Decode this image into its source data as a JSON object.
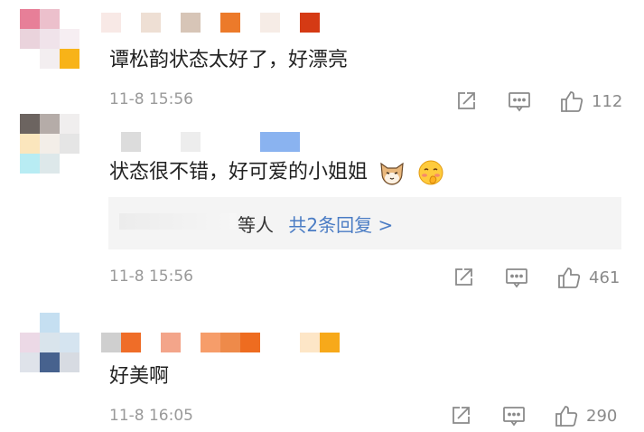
{
  "comments": [
    {
      "text": "谭松韵状态太好了，好漂亮",
      "time": "11-8 15:56",
      "likes": "112"
    },
    {
      "text": "状态很不错，好可爱的小姐姐",
      "emojis": [
        "cat-face-emoji",
        "blushing-face-emoji"
      ],
      "reply_people": "等人",
      "reply_link": "共2条回复 >",
      "time": "11-8 15:56",
      "likes": "461"
    },
    {
      "text": "好美啊",
      "time": "11-8 16:05",
      "likes": "290"
    }
  ],
  "icons": {
    "share": "share-icon",
    "comment": "comment-icon",
    "like": "thumbs-up-icon"
  },
  "colors": {
    "link": "#4a7cc4",
    "meta": "#999999",
    "icon": "#8a8a8a",
    "reply_bg": "#f4f4f4"
  }
}
